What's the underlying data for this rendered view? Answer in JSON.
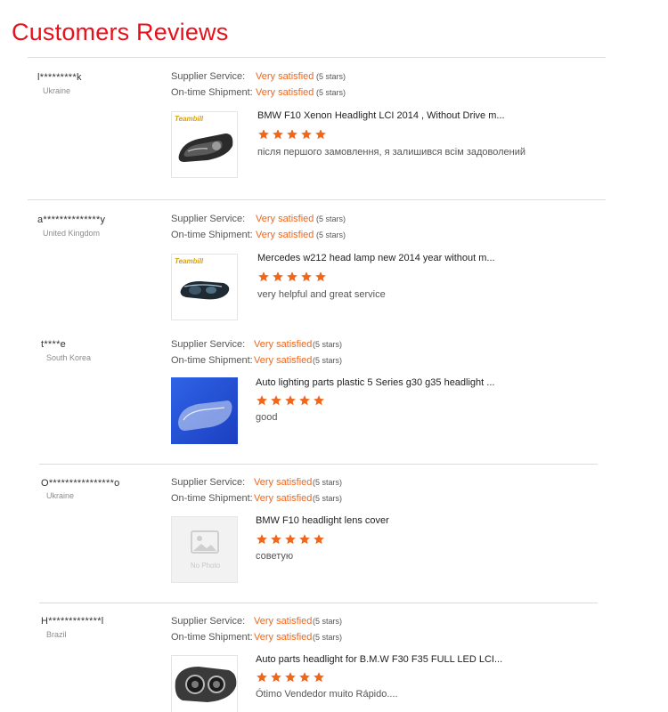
{
  "page": {
    "title": "Customers Reviews"
  },
  "labels": {
    "supplier_service": "Supplier Service:",
    "shipment": "On-time Shipment:"
  },
  "colors": {
    "accent": "#f0661a",
    "title": "#e8101b",
    "star": "#f0661a"
  },
  "icons": {
    "rating": "star-icon",
    "placeholder": "image-placeholder-icon"
  },
  "reviews": [
    {
      "user": "l*********k",
      "country": "Ukraine",
      "supplier_value": "Very satisfied",
      "supplier_stars": "(5 stars)",
      "shipment_value": "Very satisfied",
      "shipment_stars": "(5 stars)",
      "product_title": "BMW F10 Xenon Headlight LCI 2014 , Without Drive m...",
      "rating": 5,
      "brand": "Teambill",
      "comment": "після першого замовлення, я залишився всім задоволений"
    },
    {
      "user": "a**************y",
      "country": "United Kingdom",
      "supplier_value": "Very satisfied",
      "supplier_stars": "(5 stars)",
      "shipment_value": "Very satisfied",
      "shipment_stars": "(5 stars)",
      "product_title": "Mercedes w212 head lamp new 2014 year without m...",
      "rating": 5,
      "brand": "Teambill",
      "comment": "very helpful and great service"
    },
    {
      "user": "t****e",
      "country": "South Korea",
      "supplier_value": "Very satisfied",
      "supplier_stars": "(5 stars)",
      "shipment_value": "Very satisfied",
      "shipment_stars": "(5 stars)",
      "product_title": "Auto lighting parts plastic 5 Series g30 g35 headlight ...",
      "rating": 5,
      "comment": "good"
    },
    {
      "user": "O****************o",
      "country": "Ukraine",
      "supplier_value": "Very satisfied",
      "supplier_stars": "(5 stars)",
      "shipment_value": "Very satisfied",
      "shipment_stars": "(5 stars)",
      "product_title": "BMW F10 headlight lens cover",
      "rating": 5,
      "no_photo": "No Photo",
      "comment": "советую"
    },
    {
      "user": "H*************l",
      "country": "Brazil",
      "supplier_value": "Very satisfied",
      "supplier_stars": "(5 stars)",
      "shipment_value": "Very satisfied",
      "shipment_stars": "(5 stars)",
      "product_title": "Auto parts headlight for B.M.W F30 F35 FULL LED LCI...",
      "rating": 5,
      "comment": "Ótimo Vendedor muito Rápido...."
    }
  ]
}
